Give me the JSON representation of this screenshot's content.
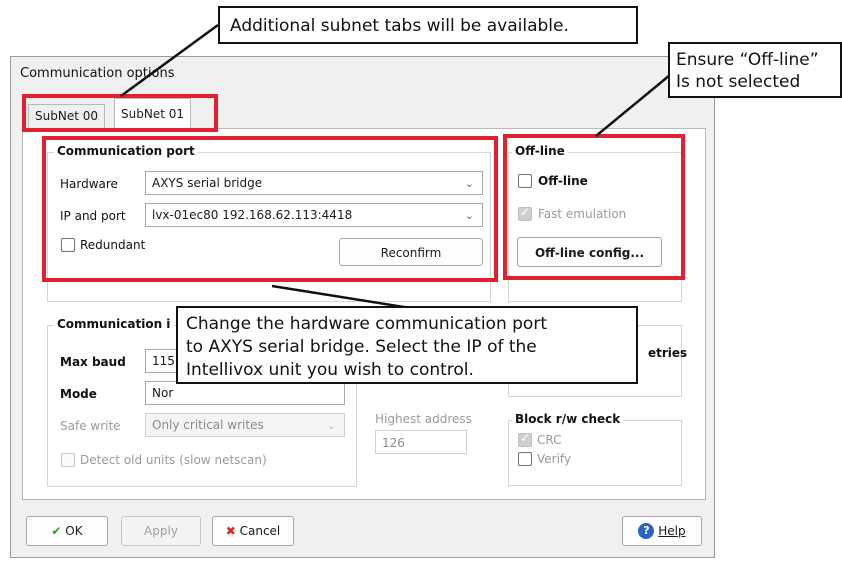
{
  "annotations": {
    "top": "Additional subnet tabs will be available.",
    "right_line1": "Ensure “Off-line”",
    "right_line2": "Is not selected",
    "middle_line1": "Change the hardware communication port",
    "middle_line2": "to AXYS serial bridge.  Select the IP of the",
    "middle_line3": "Intellivox unit you wish to control."
  },
  "dialog": {
    "title": "Communication options",
    "tabs": [
      {
        "label": "SubNet 00",
        "active": false
      },
      {
        "label": "SubNet 01",
        "active": true
      }
    ],
    "comm_port": {
      "legend": "Communication port",
      "hardware_label": "Hardware",
      "hardware_value": "AXYS serial bridge",
      "ip_label": "IP and port",
      "ip_value": "lvx-01ec80 192.168.62.113:4418",
      "redundant_label": "Redundant",
      "reconfirm_label": "Reconfirm"
    },
    "offline": {
      "legend": "Off-line",
      "offline_label": "Off-line",
      "fast_emulation_label": "Fast emulation",
      "config_button": "Off-line config..."
    },
    "comm_settings": {
      "legend_visible": "Communication i",
      "max_baud_label": "Max baud",
      "max_baud_value": "115",
      "mode_label": "Mode",
      "mode_value": "Nor",
      "safe_write_label": "Safe write",
      "safe_write_value": "Only critical writes",
      "detect_old_label": "Detect old units (slow netscan)"
    },
    "retries_label": "etries",
    "highest_address": {
      "label": "Highest address",
      "value": "126"
    },
    "block_check": {
      "legend": "Block r/w check",
      "crc_label": "CRC",
      "verify_label": "Verify"
    },
    "buttons": {
      "ok": "OK",
      "apply": "Apply",
      "cancel": "Cancel",
      "help": "Help"
    }
  },
  "colors": {
    "highlight_red": "#e02230",
    "ok_green": "#2f9a2f",
    "cancel_red": "#d62a2a",
    "help_blue": "#2a64c9"
  }
}
